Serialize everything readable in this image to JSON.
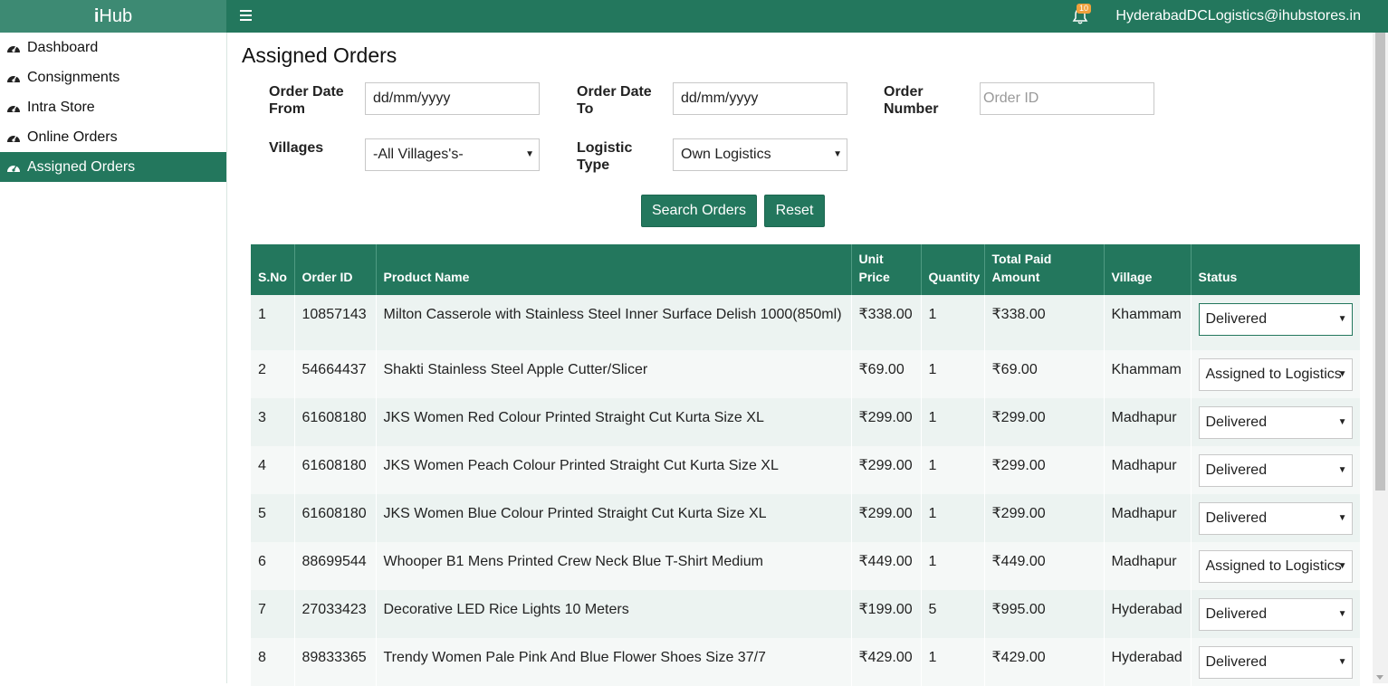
{
  "app": {
    "brand_i": "i",
    "brand_rest": "Hub"
  },
  "header": {
    "notification_count": "10",
    "user_email": "HyderabadDCLogistics@ihubstores.in"
  },
  "sidebar": {
    "items": [
      {
        "label": "Dashboard",
        "active": false
      },
      {
        "label": "Consignments",
        "active": false
      },
      {
        "label": "Intra Store",
        "active": false
      },
      {
        "label": "Online Orders",
        "active": false
      },
      {
        "label": "Assigned Orders",
        "active": true
      }
    ]
  },
  "page": {
    "title": "Assigned Orders"
  },
  "filters": {
    "order_date_from": {
      "label_line1": "Order Date",
      "label_line2": "From",
      "value": "dd/mm/yyyy"
    },
    "order_date_to": {
      "label_line1": "Order Date",
      "label_line2": "To",
      "value": "dd/mm/yyyy"
    },
    "order_number": {
      "label_line1": "Order",
      "label_line2": "Number",
      "placeholder": "Order ID"
    },
    "villages": {
      "label": "Villages",
      "selected": "-All Villages's-"
    },
    "logistic_type": {
      "label_line1": "Logistic",
      "label_line2": "Type",
      "selected": "Own Logistics"
    },
    "search_button": "Search Orders",
    "reset_button": "Reset"
  },
  "table": {
    "headers": {
      "sno": "S.No",
      "order_id": "Order ID",
      "product": "Product Name",
      "unit_price_1": "Unit",
      "unit_price_2": "Price",
      "quantity": "Quantity",
      "total_1": "Total Paid",
      "total_2": "Amount",
      "village": "Village",
      "status": "Status"
    },
    "rows": [
      {
        "sno": "1",
        "order_id": "10857143",
        "product": "Milton Casserole with Stainless Steel Inner Surface Delish 1000(850ml)",
        "unit_price": "₹338.00",
        "quantity": "1",
        "total": "₹338.00",
        "village": "Khammam",
        "status": "Delivered"
      },
      {
        "sno": "2",
        "order_id": "54664437",
        "product": "Shakti Stainless Steel Apple Cutter/Slicer",
        "unit_price": "₹69.00",
        "quantity": "1",
        "total": "₹69.00",
        "village": "Khammam",
        "status": "Assigned to Logistics"
      },
      {
        "sno": "3",
        "order_id": "61608180",
        "product": "JKS Women Red Colour Printed Straight Cut Kurta Size XL",
        "unit_price": "₹299.00",
        "quantity": "1",
        "total": "₹299.00",
        "village": "Madhapur",
        "status": "Delivered"
      },
      {
        "sno": "4",
        "order_id": "61608180",
        "product": "JKS Women Peach Colour Printed Straight Cut Kurta Size XL",
        "unit_price": "₹299.00",
        "quantity": "1",
        "total": "₹299.00",
        "village": "Madhapur",
        "status": "Delivered"
      },
      {
        "sno": "5",
        "order_id": "61608180",
        "product": "JKS Women Blue Colour Printed Straight Cut Kurta Size XL",
        "unit_price": "₹299.00",
        "quantity": "1",
        "total": "₹299.00",
        "village": "Madhapur",
        "status": "Delivered"
      },
      {
        "sno": "6",
        "order_id": "88699544",
        "product": "Whooper B1 Mens Printed Crew Neck Blue T-Shirt Medium",
        "unit_price": "₹449.00",
        "quantity": "1",
        "total": "₹449.00",
        "village": "Madhapur",
        "status": "Assigned to Logistics"
      },
      {
        "sno": "7",
        "order_id": "27033423",
        "product": "Decorative LED Rice Lights 10 Meters",
        "unit_price": "₹199.00",
        "quantity": "5",
        "total": "₹995.00",
        "village": "Hyderabad",
        "status": "Delivered"
      },
      {
        "sno": "8",
        "order_id": "89833365",
        "product": "Trendy Women Pale Pink And Blue Flower Shoes Size 37/7",
        "unit_price": "₹429.00",
        "quantity": "1",
        "total": "₹429.00",
        "village": "Hyderabad",
        "status": "Delivered"
      }
    ]
  },
  "colors": {
    "primary": "#23775d",
    "brand_bg": "#3d8a73",
    "row_alt": "#ecf3f1",
    "badge": "#f0a13c"
  }
}
